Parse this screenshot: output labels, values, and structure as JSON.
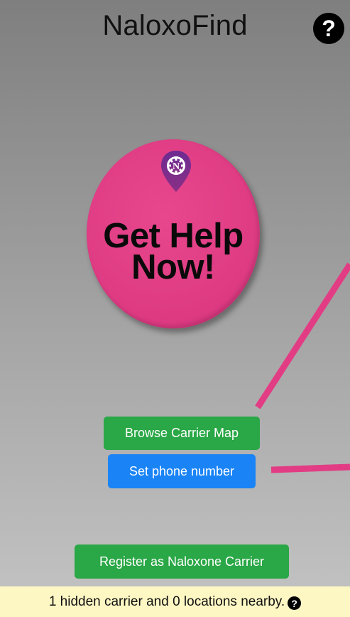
{
  "header": {
    "title": "NaloxoFind",
    "help_icon": "question-circle-icon"
  },
  "main": {
    "get_help_label": "Get Help\nNow!",
    "logo_letter": "N",
    "browse_map_label": "Browse Carrier Map",
    "set_phone_label": "Set phone number",
    "register_label": "Register as Naloxone Carrier"
  },
  "footer": {
    "status_text": "1 hidden carrier and 0 locations nearby.",
    "help_icon": "question-circle-icon"
  },
  "colors": {
    "accent_pink": "#dd3a82",
    "green_button": "#2aa746",
    "blue_button": "#1a84f6",
    "footer_bg": "#fdf7c4"
  }
}
